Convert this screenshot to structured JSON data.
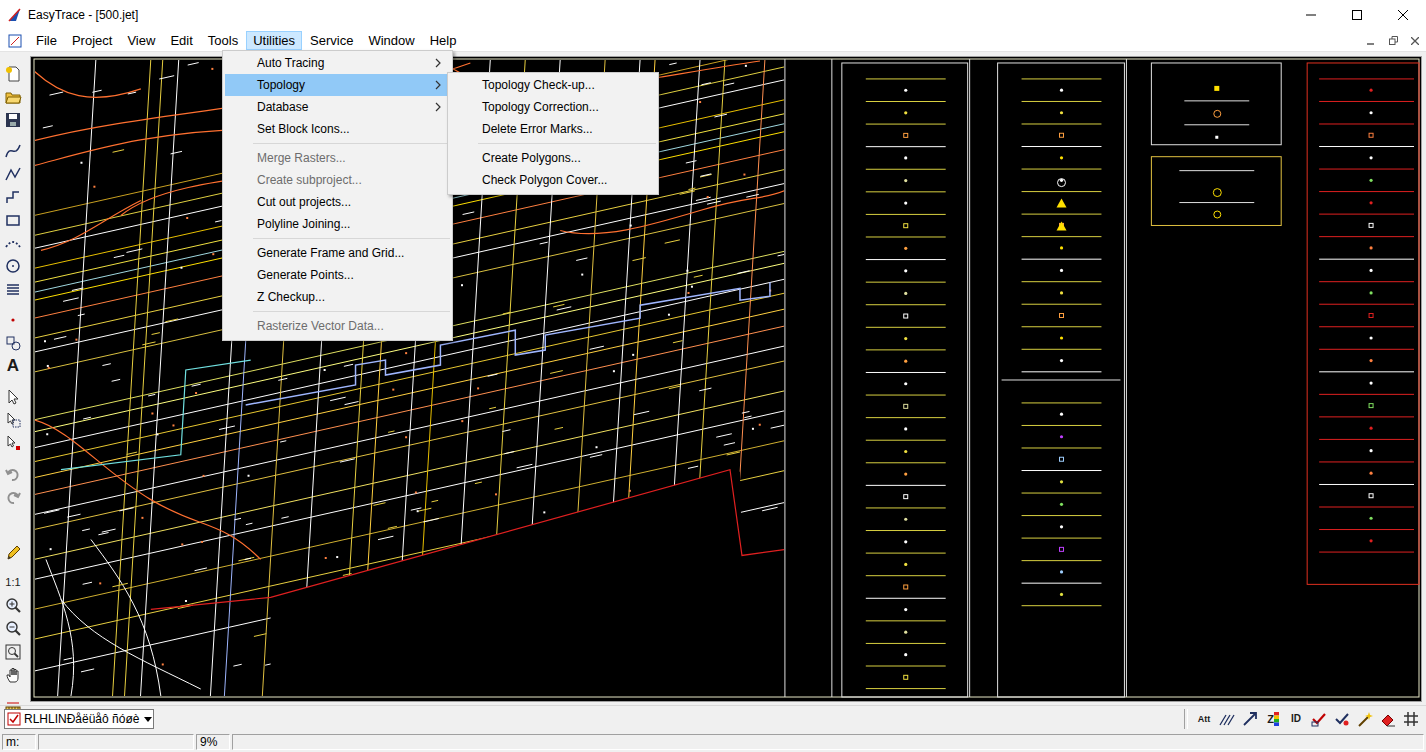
{
  "window": {
    "title": "EasyTrace - [500.jet]"
  },
  "menubar": [
    {
      "label": "File",
      "selected": false
    },
    {
      "label": "Project",
      "selected": false
    },
    {
      "label": "View",
      "selected": false
    },
    {
      "label": "Edit",
      "selected": false
    },
    {
      "label": "Tools",
      "selected": false
    },
    {
      "label": "Utilities",
      "selected": true
    },
    {
      "label": "Service",
      "selected": false
    },
    {
      "label": "Window",
      "selected": false
    },
    {
      "label": "Help",
      "selected": false
    }
  ],
  "utilities_menu": {
    "items": [
      {
        "label": "Auto Tracing",
        "kind": "submenu",
        "disabled": false,
        "selected": false
      },
      {
        "label": "Topology",
        "kind": "submenu",
        "disabled": false,
        "selected": true
      },
      {
        "label": "Database",
        "kind": "submenu",
        "disabled": false,
        "selected": false
      },
      {
        "label": "Set Block Icons...",
        "kind": "item",
        "disabled": false,
        "selected": false
      },
      {
        "kind": "separator"
      },
      {
        "label": "Merge Rasters...",
        "kind": "item",
        "disabled": true,
        "selected": false
      },
      {
        "label": "Create subproject...",
        "kind": "item",
        "disabled": true,
        "selected": false
      },
      {
        "label": "Cut out projects...",
        "kind": "item",
        "disabled": false,
        "selected": false
      },
      {
        "label": "Polyline Joining...",
        "kind": "item",
        "disabled": false,
        "selected": false
      },
      {
        "kind": "separator"
      },
      {
        "label": "Generate Frame and Grid...",
        "kind": "item",
        "disabled": false,
        "selected": false
      },
      {
        "label": "Generate Points...",
        "kind": "item",
        "disabled": false,
        "selected": false
      },
      {
        "label": "Z Checkup...",
        "kind": "item",
        "disabled": false,
        "selected": false
      },
      {
        "kind": "separator"
      },
      {
        "label": "Rasterize Vector Data...",
        "kind": "item",
        "disabled": true,
        "selected": false
      }
    ]
  },
  "topology_submenu": {
    "items": [
      {
        "label": "Topology Check-up...",
        "kind": "item",
        "disabled": false,
        "selected": false
      },
      {
        "label": "Topology Correction...",
        "kind": "item",
        "disabled": false,
        "selected": false
      },
      {
        "label": "Delete Error Marks...",
        "kind": "item",
        "disabled": false,
        "selected": false
      },
      {
        "kind": "separator"
      },
      {
        "label": "Create Polygons...",
        "kind": "item",
        "disabled": false,
        "selected": false
      },
      {
        "label": "Check Polygon Cover...",
        "kind": "item",
        "disabled": false,
        "selected": false
      }
    ]
  },
  "left_toolbar": {
    "text_tool": "A",
    "scale_button": "1:1"
  },
  "layer_select": {
    "value": "RLHLINÐåëüåô ñóøè"
  },
  "bottom_toolbar": {
    "attributes_button": "Att",
    "z_button": "Z",
    "id_button": "ID"
  },
  "status_bar": {
    "coords_label": "m:",
    "zoom": "9%"
  }
}
